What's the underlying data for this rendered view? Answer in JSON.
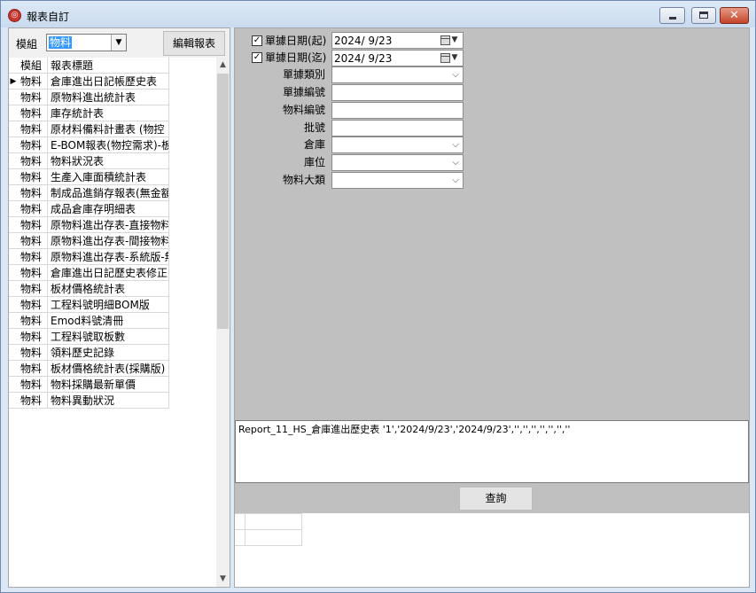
{
  "window": {
    "title": "報表自訂",
    "icon": "app-logo-icon",
    "controls": {
      "minimize": "minimize-icon",
      "maximize": "maximize-icon",
      "close": "close-icon"
    }
  },
  "left_panel": {
    "group_label": "模組",
    "group_value": "物料",
    "edit_button": "編輯報表",
    "grid": {
      "headers": [
        "模組",
        "報表標題"
      ],
      "rows": [
        [
          "物料",
          "倉庫進出日記帳歷史表"
        ],
        [
          "物料",
          "原物料進出統計表"
        ],
        [
          "物料",
          "庫存統計表"
        ],
        [
          "物料",
          "原材料備料計畫表 (物控"
        ],
        [
          "物料",
          "E-BOM報表(物控需求)-板柞"
        ],
        [
          "物料",
          "物料狀況表"
        ],
        [
          "物料",
          "生產入庫面積統計表"
        ],
        [
          "物料",
          "制成品進銷存報表(無金額"
        ],
        [
          "物料",
          "成品倉庫存明細表"
        ],
        [
          "物料",
          "原物料進出存表-直接物料"
        ],
        [
          "物料",
          "原物料進出存表-間接物料"
        ],
        [
          "物料",
          "原物料進出存表-系統版-無"
        ],
        [
          "物料",
          "倉庫進出日記歷史表修正Ⅰ"
        ],
        [
          "物料",
          "板材價格統計表"
        ],
        [
          "物料",
          "工程料號明細BOM版"
        ],
        [
          "物料",
          "Emod料號清冊"
        ],
        [
          "物料",
          "工程料號取板數"
        ],
        [
          "物料",
          "領料歷史記錄"
        ],
        [
          "物料",
          "板材價格統計表(採購版)"
        ],
        [
          "物料",
          "物料採購最新單價"
        ],
        [
          "物料",
          "物料異動狀況"
        ]
      ],
      "selected_row": 0
    }
  },
  "filters": {
    "date_from": {
      "label": "單據日期(起)",
      "checked": true,
      "value": "2024/  9/23"
    },
    "date_to": {
      "label": "單據日期(迄)",
      "checked": true,
      "value": "2024/  9/23"
    },
    "doc_type": {
      "label": "單據類別",
      "value": ""
    },
    "doc_no": {
      "label": "單據編號",
      "value": ""
    },
    "material_no": {
      "label": "物料編號",
      "value": ""
    },
    "batch_no": {
      "label": "批號",
      "value": ""
    },
    "warehouse": {
      "label": "倉庫",
      "value": ""
    },
    "location": {
      "label": "庫位",
      "value": ""
    },
    "material_category": {
      "label": "物料大類",
      "value": ""
    }
  },
  "sql_text": "Report_11_HS_倉庫進出歷史表 '1','2024/9/23','2024/9/23','','','','','','',''",
  "query_button": "查詢",
  "colors": {
    "titlebar": "#c9dbef",
    "selection": "#3399ff",
    "panel_gray": "#c0c0c0",
    "close_red": "#c4442a"
  }
}
